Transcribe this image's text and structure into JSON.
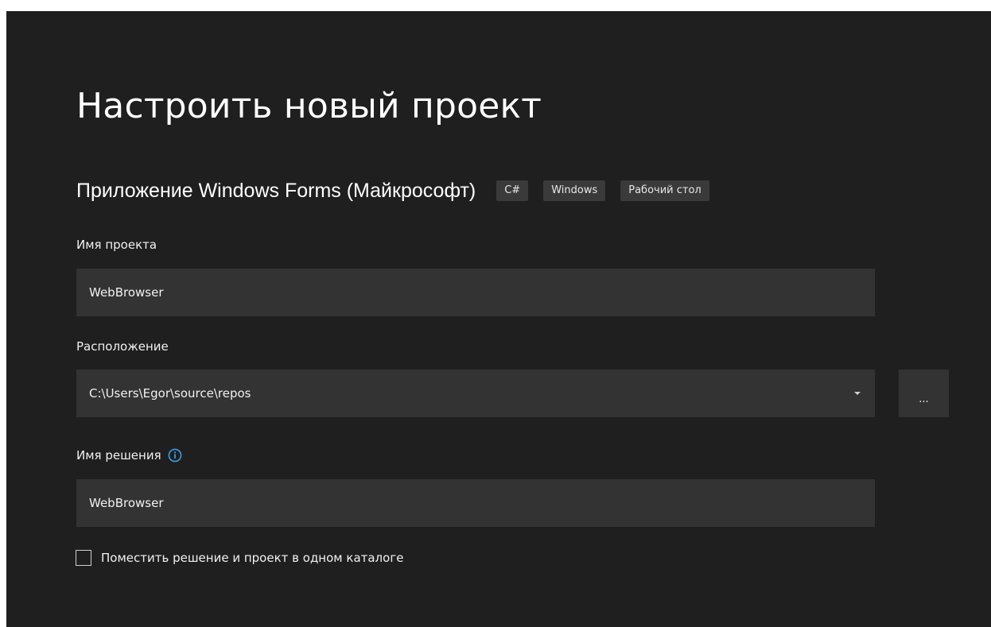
{
  "page": {
    "title": "Настроить новый проект"
  },
  "template": {
    "name": "Приложение Windows Forms (Майкрософт)",
    "tags": [
      "C#",
      "Windows",
      "Рабочий стол"
    ]
  },
  "project_name": {
    "label": "Имя проекта",
    "value": "WebBrowser"
  },
  "location": {
    "label": "Расположение",
    "value": "C:\\Users\\Egor\\source\\repos",
    "browse_label": "..."
  },
  "solution_name": {
    "label": "Имя решения",
    "value": "WebBrowser"
  },
  "same_directory": {
    "label": "Поместить решение и проект в одном каталоге",
    "checked": false
  },
  "icons": {
    "info": "info-icon",
    "dropdown": "chevron-down-icon"
  },
  "colors": {
    "background": "#1f1f1f",
    "field": "#333333",
    "tag": "#3a3a3a",
    "accent": "#3c9ce6"
  }
}
